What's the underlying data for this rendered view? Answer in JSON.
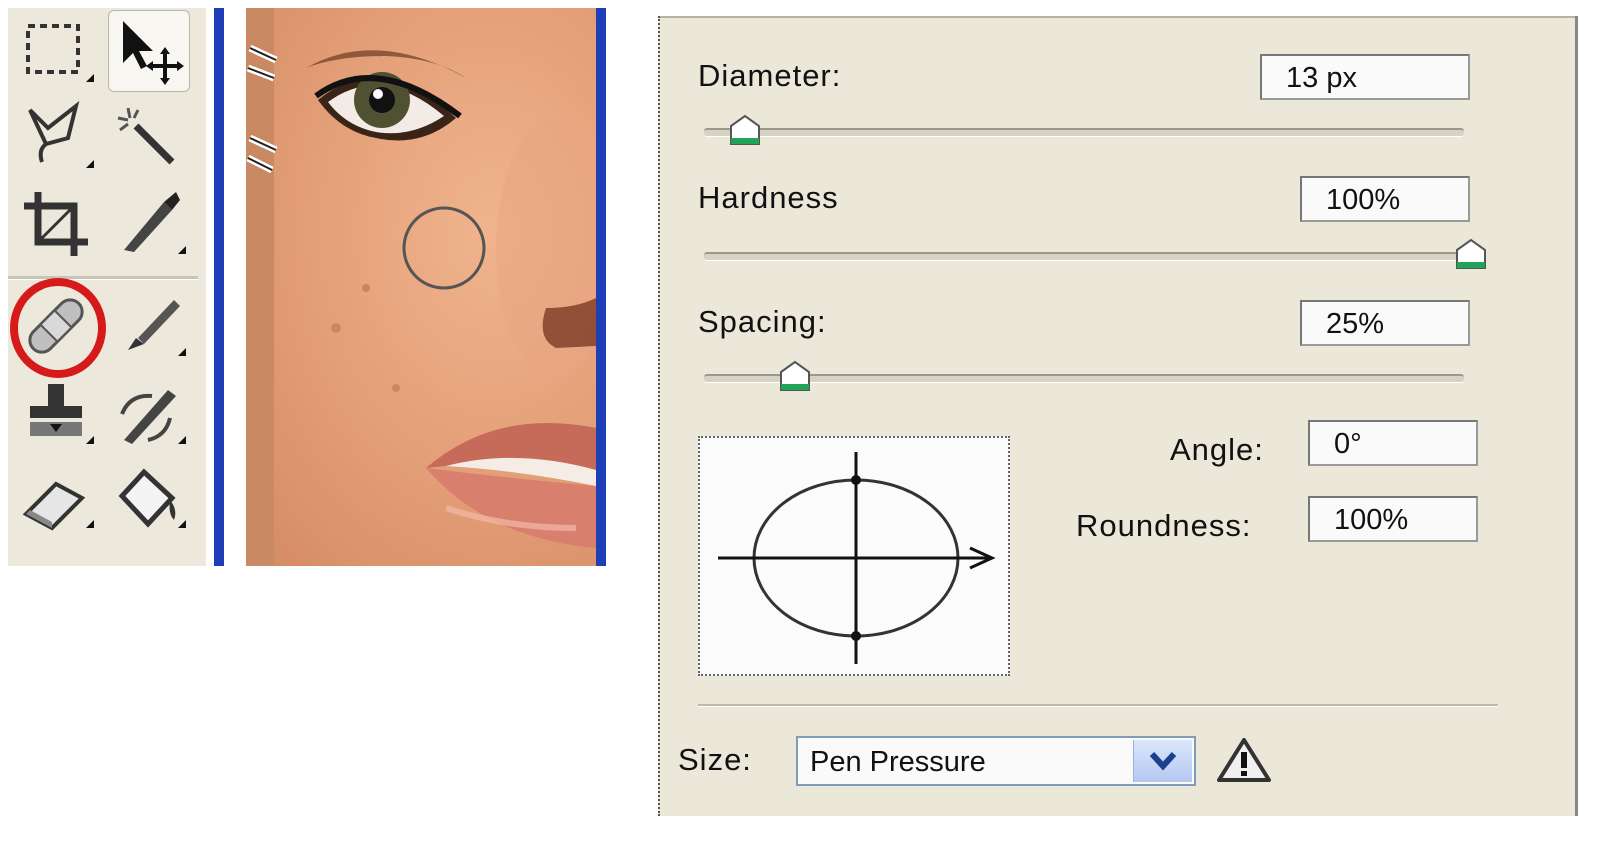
{
  "tools": [
    {
      "name": "marquee-tool-icon"
    },
    {
      "name": "move-tool-icon"
    },
    {
      "name": "lasso-tool-icon"
    },
    {
      "name": "magic-wand-tool-icon"
    },
    {
      "name": "crop-tool-icon"
    },
    {
      "name": "slice-tool-icon"
    },
    {
      "name": "healing-brush-tool-icon",
      "highlighted": true,
      "highlight_color": "#d61a1a"
    },
    {
      "name": "brush-tool-icon"
    },
    {
      "name": "clone-stamp-tool-icon"
    },
    {
      "name": "history-brush-tool-icon"
    },
    {
      "name": "eraser-tool-icon"
    },
    {
      "name": "paint-bucket-tool-icon"
    }
  ],
  "brush_panel": {
    "diameter": {
      "label": "Diameter:",
      "value": "13 px",
      "slider_fraction": 0.05
    },
    "hardness": {
      "label": "Hardness",
      "value": "100%",
      "slider_fraction": 1.0
    },
    "spacing": {
      "label": "Spacing:",
      "value": "25%",
      "slider_fraction": 0.12
    },
    "angle": {
      "label": "Angle:",
      "value": "0°"
    },
    "roundness": {
      "label": "Roundness:",
      "value": "100%"
    },
    "size_control": {
      "label": "Size:",
      "selected": "Pen Pressure",
      "warning_icon": "warning-triangle-icon"
    }
  },
  "colors": {
    "panel_bg": "#ebe8da",
    "accent_blue": "#1f3fb8",
    "highlight_red": "#d61a1a",
    "slider_thumb": "#22a35a"
  }
}
